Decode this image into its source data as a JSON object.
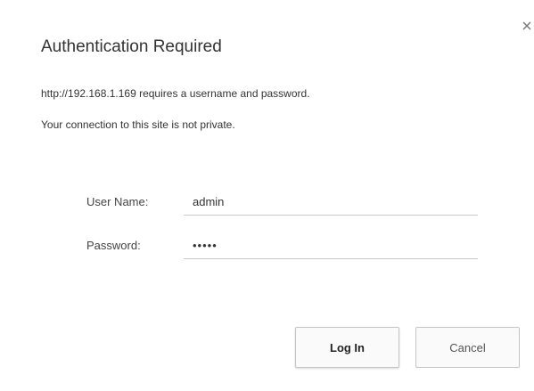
{
  "dialog": {
    "title": "Authentication Required",
    "message_line1": "http://192.168.1.169 requires a username and password.",
    "message_line2": "Your connection to this site is not private.",
    "close_icon": "close-icon",
    "username_label": "User Name:",
    "username_value": "admin",
    "password_label": "Password:",
    "password_value": "•••••",
    "login_label": "Log In",
    "cancel_label": "Cancel"
  }
}
